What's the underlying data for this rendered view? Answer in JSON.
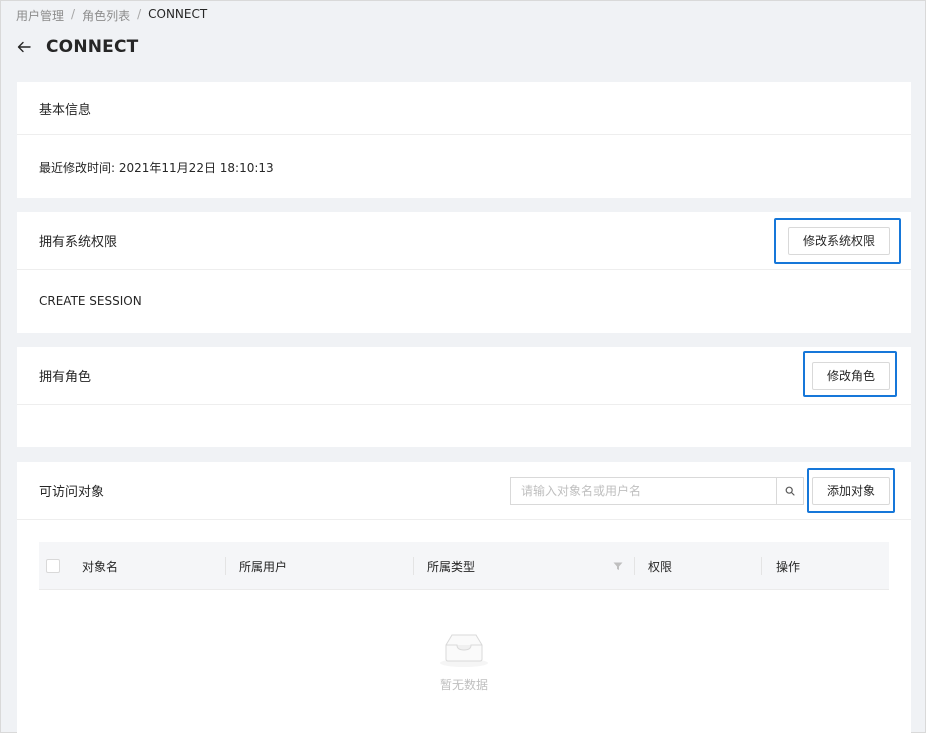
{
  "breadcrumb": {
    "items": [
      "用户管理",
      "角色列表"
    ],
    "separator": "/",
    "current": "CONNECT"
  },
  "header": {
    "title": "CONNECT"
  },
  "basic_info": {
    "title": "基本信息",
    "modified_label": "最近修改时间:",
    "modified_value": "2021年11月22日 18:10:13"
  },
  "system_privileges": {
    "title": "拥有系统权限",
    "edit_button": "修改系统权限",
    "items": [
      "CREATE SESSION"
    ]
  },
  "roles": {
    "title": "拥有角色",
    "edit_button": "修改角色"
  },
  "objects": {
    "title": "可访问对象",
    "search_placeholder": "请输入对象名或用户名",
    "add_button": "添加对象",
    "columns": [
      "对象名",
      "所属用户",
      "所属类型",
      "权限",
      "操作"
    ],
    "empty_text": "暂无数据"
  },
  "colors": {
    "highlight": "#1677d9",
    "background": "#f0f2f5"
  }
}
